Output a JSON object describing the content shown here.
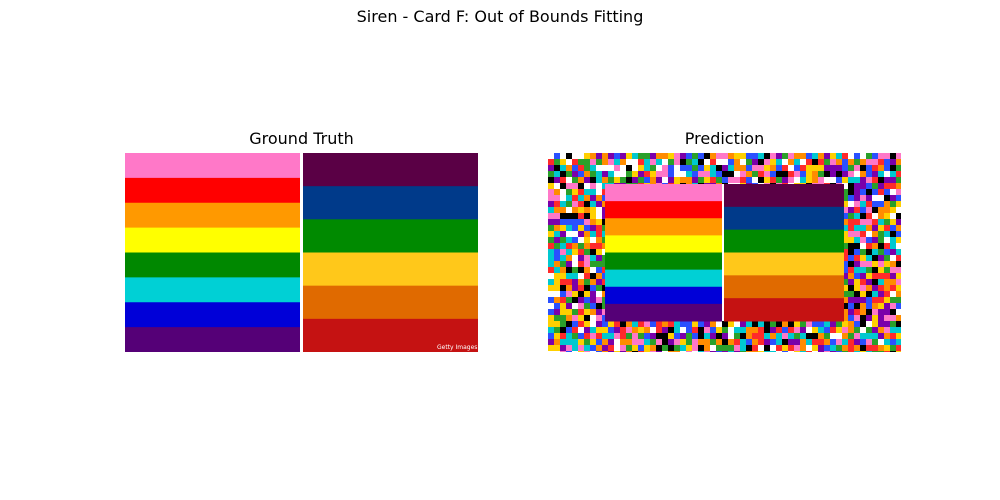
{
  "figure": {
    "suptitle": "Siren - Card F: Out of Bounds Fitting",
    "panels": [
      {
        "title": "Ground Truth"
      },
      {
        "title": "Prediction"
      }
    ],
    "watermark_text": "Getty Images"
  },
  "colors": {
    "left_flag": [
      "#ff78c8",
      "#ff0000",
      "#ff9900",
      "#ffff00",
      "#008800",
      "#00d0d5",
      "#0000d8",
      "#550077"
    ],
    "right_flag": [
      "#5a0045",
      "#003a8a",
      "#008a00",
      "#ffc81a",
      "#e06a00",
      "#c51212"
    ],
    "divider": "#ffffff",
    "noise_palette": [
      "#ff2a2a",
      "#ffd000",
      "#2aa02a",
      "#2a50ff",
      "#ff78c8",
      "#00c8d0",
      "#ffffff",
      "#7a00aa",
      "#ff8c00",
      "#000000"
    ]
  }
}
